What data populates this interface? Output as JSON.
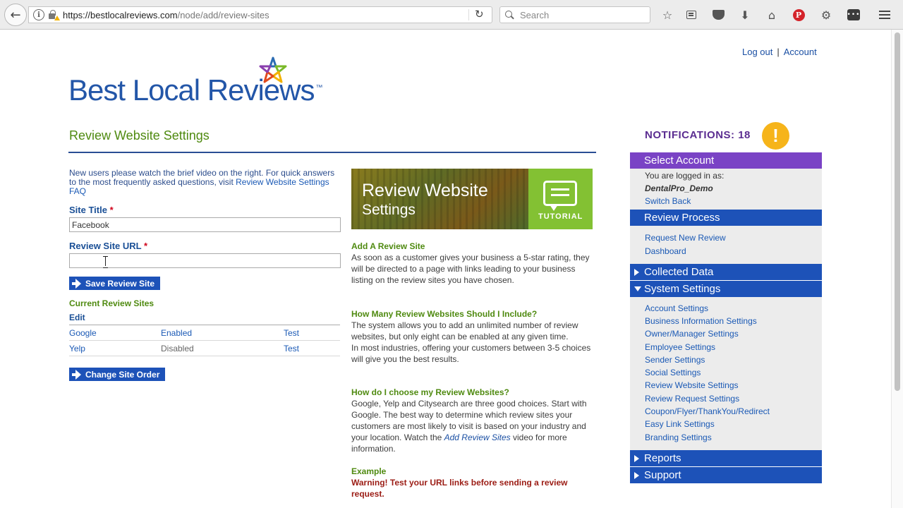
{
  "browser": {
    "url_host": "https://bestlocalreviews.com",
    "url_path": "/node/add/review-sites",
    "search_placeholder": "Search"
  },
  "header": {
    "logout": "Log out",
    "separator": "|",
    "account": "Account"
  },
  "logo": {
    "text": "Best Local Reviews",
    "tm": "™",
    "star_colors": [
      "#2b6cb3",
      "#7ab929",
      "#f2b200",
      "#e04a1e",
      "#8a3fae"
    ]
  },
  "main": {
    "title": "Review Website Settings",
    "intro_text": "New users please watch the brief video on the right. For quick answers to the most frequently asked questions, visit ",
    "intro_link": "Review Website Settings FAQ",
    "site_title_label": "Site Title",
    "site_title_value": "Facebook",
    "site_url_label": "Review Site URL",
    "required_mark": "*",
    "save_button": "Save Review Site",
    "current_sites_label": "Current Review Sites",
    "edit_label": "Edit",
    "sites": [
      {
        "name": "Google",
        "status": "Enabled",
        "action": "Test"
      },
      {
        "name": "Yelp",
        "status": "Disabled",
        "action": "Test"
      }
    ],
    "change_order_button": "Change Site Order"
  },
  "banner": {
    "title": "Review Website",
    "subtitle": "Settings",
    "tutorial_label": "TUTORIAL"
  },
  "help": {
    "h1": "Add A Review Site",
    "p1": "As soon as a customer gives your business a 5-star rating, they will be directed to a page with links leading to your business listing on the review sites you have chosen.",
    "h2": "How Many Review Websites Should I Include?",
    "p2a": "The system allows you to add an unlimited number of review websites, but only eight can be enabled at any given time.",
    "p2b": "In most industries, offering your customers between 3-5 choices will give you the best results.",
    "h3": "How do I choose my Review Websites?",
    "p3_pre": "Google, Yelp and Citysearch are three good choices. Start with Google. The best way to determine which review sites your customers are most likely to visit is based on your industry and your location. Watch the ",
    "p3_em": "Add Review Sites",
    "p3_post": " video for more information.",
    "h4": "Example",
    "warning": "Warning! Test your URL links before sending a review request."
  },
  "sidebar": {
    "notifications_label": "NOTIFICATIONS: 18",
    "notification_icon": "!",
    "select_account": "Select Account",
    "logged_in_as": "You are logged in as:",
    "username": "DentalPro_Demo",
    "switch_back": "Switch Back",
    "review_process": "Review Process",
    "review_process_links": [
      "Request New Review",
      "Dashboard"
    ],
    "collected_data": "Collected Data",
    "system_settings": "System Settings",
    "system_links": [
      "Account Settings",
      "Business Information Settings",
      "Owner/Manager Settings",
      "Employee Settings",
      "Sender Settings",
      "Social Settings",
      "Review Website Settings",
      "Review Request Settings",
      "Coupon/Flyer/ThankYou/Redirect",
      "Easy Link Settings",
      "Branding Settings"
    ],
    "reports": "Reports",
    "support": "Support"
  }
}
